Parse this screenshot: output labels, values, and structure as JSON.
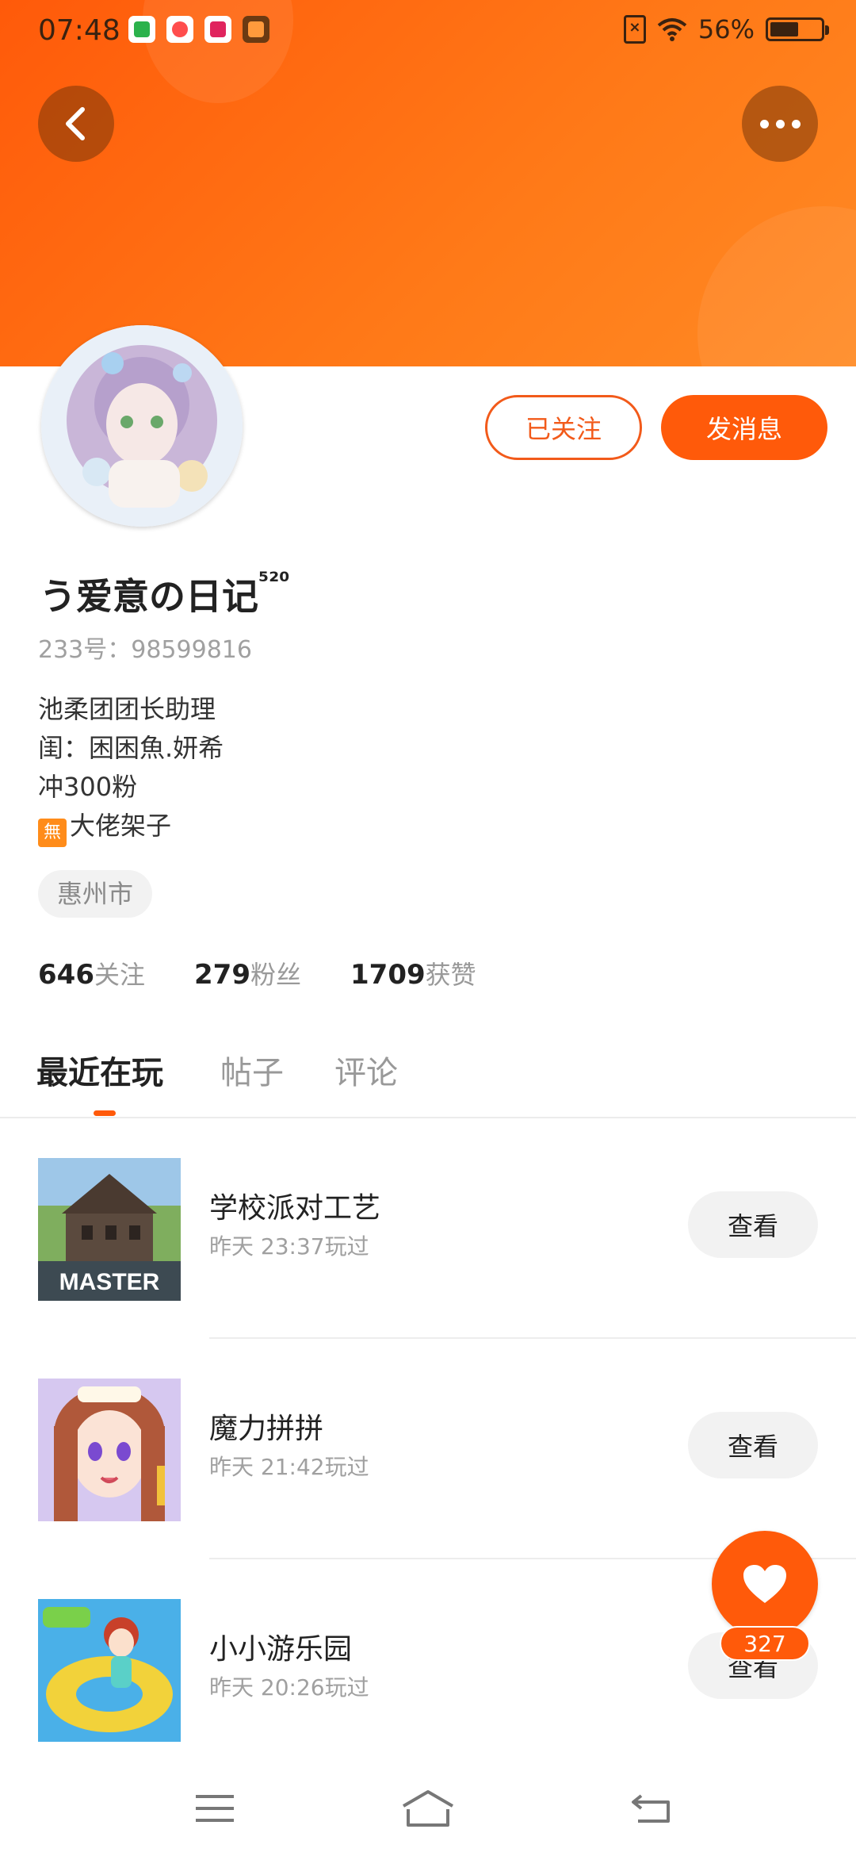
{
  "status_bar": {
    "time": "07:48",
    "battery": "56%",
    "battery_level": 0.56,
    "icons": [
      "sim-missing-icon",
      "wifi-icon",
      "battery-icon"
    ],
    "notification_icons": [
      "video-app-icon",
      "photo-app-icon",
      "player-app-icon",
      "shop-app-icon"
    ]
  },
  "header": {
    "back_icon": "chevron-left-icon",
    "more_icon": "more-dots-icon"
  },
  "profile": {
    "username": "う爱意の日记",
    "username_suffix": "⁵²⁰",
    "uid": "233号：98599816",
    "bio_lines": [
      "池柔团团长助理",
      "闺：困困魚.妍希",
      "冲300粉",
      "大佬架子"
    ],
    "bio_badge": "無",
    "location": "惠州市",
    "follow_label": "已关注",
    "message_label": "发消息",
    "stats": [
      {
        "value": "646",
        "label": "关注"
      },
      {
        "value": "279",
        "label": "粉丝"
      },
      {
        "value": "1709",
        "label": "获赞"
      }
    ]
  },
  "tabs": [
    {
      "label": "最近在玩",
      "active": true
    },
    {
      "label": "帖子",
      "active": false
    },
    {
      "label": "评论",
      "active": false
    }
  ],
  "games": [
    {
      "title": "学校派对工艺",
      "time": "昨天 23:37玩过",
      "button": "查看",
      "thumb_text": "MASTER"
    },
    {
      "title": "魔力拼拼",
      "time": "昨天 21:42玩过",
      "button": "查看"
    },
    {
      "title": "小小游乐园",
      "time": "昨天 20:26玩过",
      "button": "查看"
    }
  ],
  "like_fab": {
    "count": "327",
    "icon": "heart-icon"
  },
  "nav_bar": {
    "icons": [
      "menu-icon",
      "home-icon",
      "back-icon"
    ]
  },
  "colors": {
    "accent": "#ff5a0a",
    "header": "#ff6a10"
  }
}
